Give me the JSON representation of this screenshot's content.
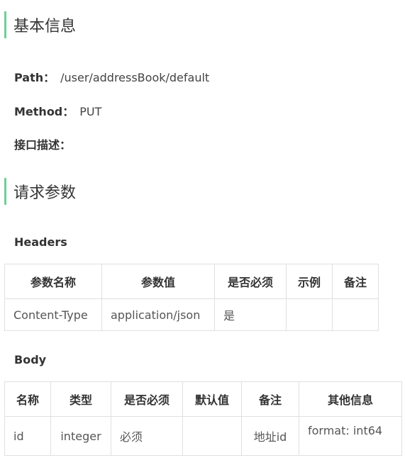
{
  "basic": {
    "title": "基本信息",
    "path_label": "Path：",
    "path_value": "/user/addressBook/default",
    "method_label": "Method：",
    "method_value": "PUT",
    "desc_label": "接口描述："
  },
  "params": {
    "title": "请求参数",
    "headers_title": "Headers",
    "headers_columns": [
      "参数名称",
      "参数值",
      "是否必须",
      "示例",
      "备注"
    ],
    "headers_rows": [
      [
        "Content-Type",
        "application/json",
        "是",
        "",
        ""
      ]
    ],
    "body_title": "Body",
    "body_columns": [
      "名称",
      "类型",
      "是否必须",
      "默认值",
      "备注",
      "其他信息"
    ],
    "body_rows": [
      [
        "id",
        "integer",
        "必须",
        "",
        "地址id",
        "format: int64"
      ]
    ]
  },
  "colors": {
    "accent": "#6fcf97",
    "border": "#e0e0e0"
  }
}
